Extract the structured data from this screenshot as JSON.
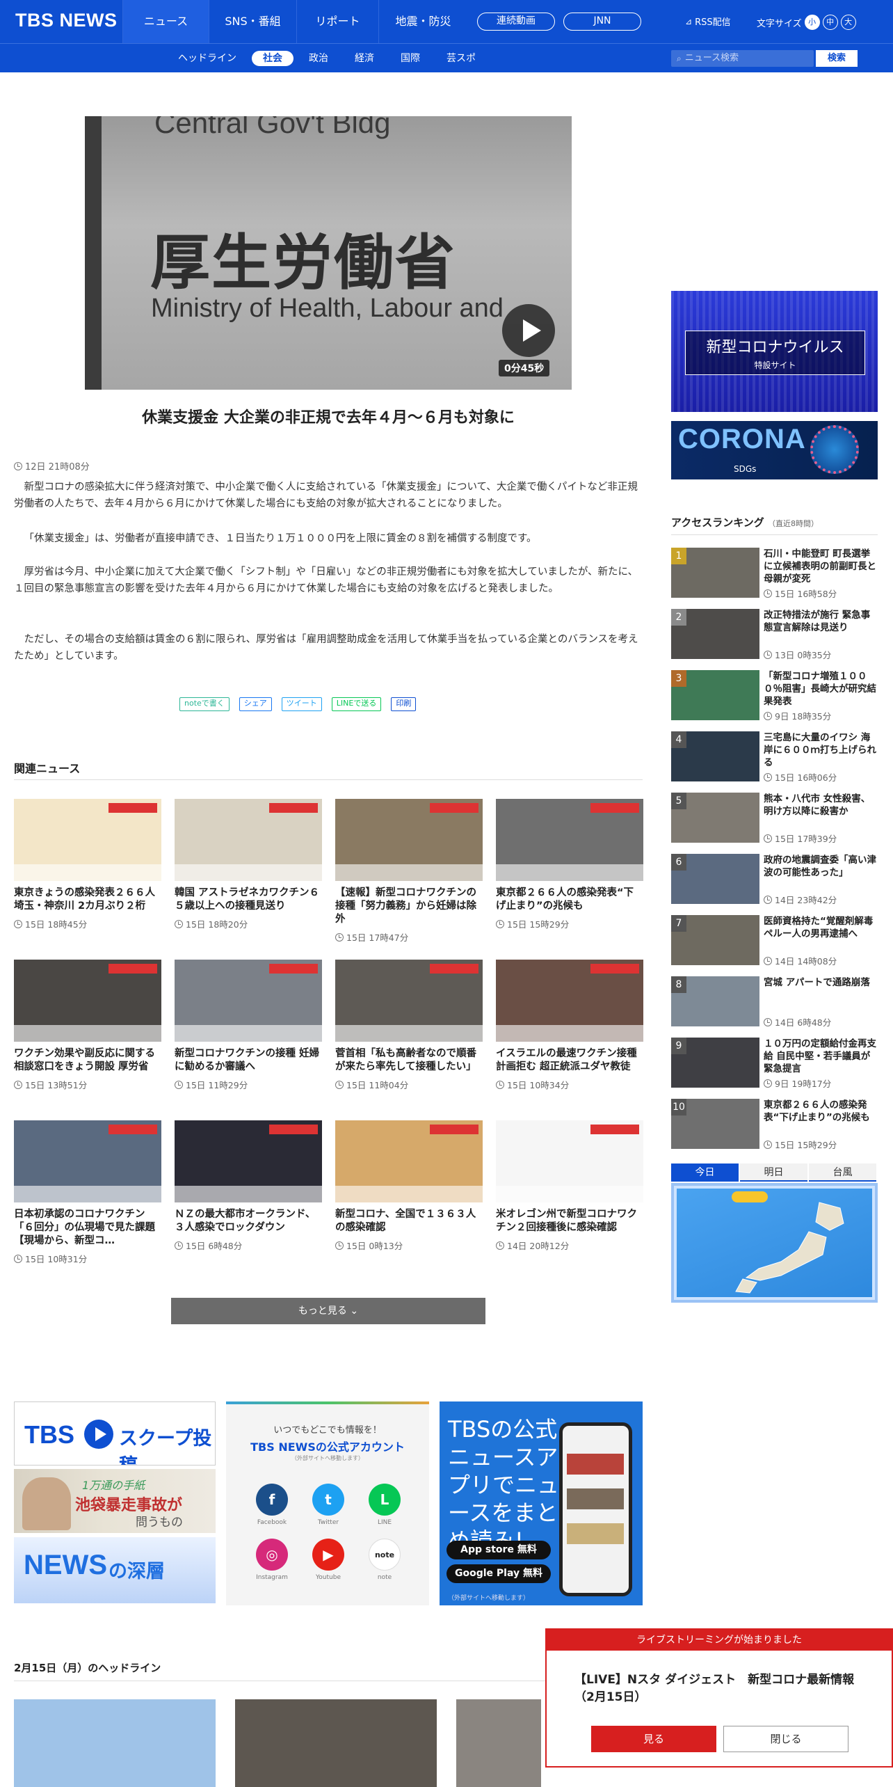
{
  "header": {
    "logo": "TBS NEWS",
    "nav": [
      {
        "label": "ニュース",
        "w": 124,
        "active": true
      },
      {
        "label": "SNS・番組",
        "w": 126
      },
      {
        "label": "リポート",
        "w": 118
      },
      {
        "label": "地震・防災",
        "w": 128
      }
    ],
    "pill_live": "連続動画",
    "pill_jnn": "JNN",
    "rss": "RSS配信",
    "font_size_label": "文字サイズ",
    "font_small": "小",
    "font_mid": "中",
    "font_large": "大"
  },
  "subnav": {
    "items": [
      "ヘッドライン",
      "社会",
      "政治",
      "経済",
      "国際",
      "芸スポ"
    ],
    "active_index": 1,
    "search_placeholder": "ニュース検索",
    "search_button": "検索"
  },
  "article": {
    "video_text_top": "Central Gov't Bldg",
    "video_text_big": "厚生労働省",
    "video_text_en": "Ministry of Health, Labour and",
    "duration": "0分45秒",
    "title": "休業支援金 大企業の非正規で去年４月～６月も対象に",
    "date": "12日 21時08分",
    "paragraphs": [
      "新型コロナの感染拡大に伴う経済対策で、中小企業で働く人に支給されている「休業支援金」について、大企業で働くパイトなど非正規労働者の人たちで、去年４月から６月にかけて休業した場合にも支給の対象が拡大されることになりました。",
      "「休業支援金」は、労働者が直接申請でき、１日当たり１万１０００円を上限に賃金の８割を補償する制度です。",
      "厚労省は今月、中小企業に加えて大企業で働く「シフト制」や「日雇い」などの非正規労働者にも対象を拡大していましたが、新たに、１回目の緊急事態宣言の影響を受けた去年４月から６月にかけて休業した場合にも支給の対象を広げると発表しました。",
      "ただし、その場合の支給額は賃金の６割に限られ、厚労省は「雇用調整助成金を活用して休業手当を払っている企業とのバランスを考えたため」としています。"
    ],
    "share": [
      {
        "label": "noteで書く",
        "color": "#2cb696"
      },
      {
        "label": "シェア",
        "color": "#1877f2"
      },
      {
        "label": "ツイート",
        "color": "#1da1f2"
      },
      {
        "label": "LINEで送る",
        "color": "#06c755"
      },
      {
        "label": "印刷",
        "color": "#0e4fd1"
      }
    ]
  },
  "related": {
    "title": "関連ニュース",
    "items": [
      {
        "title": "東京きょうの感染発表２６６人 埼玉・神奈川 2カ月ぶり２桁",
        "time": "15日 18時45分",
        "bg": "#f3e6c8"
      },
      {
        "title": "韓国 アストラゼネカワクチン６５歳以上への接種見送り",
        "time": "15日 18時20分",
        "bg": "#d9d2c2"
      },
      {
        "title": "【速報】新型コロナワクチンの接種「努力義務」から妊婦は除外",
        "time": "15日 17時47分",
        "bg": "#8a7a62"
      },
      {
        "title": "東京都２６６人の感染発表“下げ止まり”の兆候も",
        "time": "15日 15時29分",
        "bg": "#6f6f6f"
      },
      {
        "title": "ワクチン効果や副反応に関する相談窓口をきょう開設 厚労省",
        "time": "15日 13時51分",
        "bg": "#4a4744"
      },
      {
        "title": "新型コロナワクチンの接種 妊婦に勧めるか審議へ",
        "time": "15日 11時29分",
        "bg": "#7b8088"
      },
      {
        "title": "菅首相「私も高齢者なので順番が来たら率先して接種したい」",
        "time": "15日 11時04分",
        "bg": "#5e5a55"
      },
      {
        "title": "イスラエルの最速ワクチン接種計画拒む 超正統派ユダヤ教徒",
        "time": "15日 10時34分",
        "bg": "#6a4f45"
      },
      {
        "title": "日本初承認のコロナワクチン「６回分」の仏現場で見た課題【現場から、新型コ…",
        "time": "15日 10時31分",
        "bg": "#5a6a80"
      },
      {
        "title": "ＮＺの最大都市オークランド、３人感染でロックダウン",
        "time": "15日 6時48分",
        "bg": "#2a2a35"
      },
      {
        "title": "新型コロナ、全国で１３６３人の感染確認",
        "time": "15日 0時13分",
        "bg": "#d6a96a"
      },
      {
        "title": "米オレゴン州で新型コロナワクチン２回接種後に感染確認",
        "time": "14日 20時12分",
        "bg": "#f6f6f6"
      }
    ],
    "more": "もっと見る"
  },
  "banners": {
    "scoop_a": "TBS",
    "scoop_b": "スクープ投稿",
    "ike_a": "1万通の手紙",
    "ike_b": "池袋暴走事故が",
    "ike_c": "問うもの",
    "fuka_a": "NEWS",
    "fuka_b": "の深層",
    "sns_line1": "いつでもどこでも情報を！",
    "sns_line2": "TBS NEWSの公式アカウント",
    "sns_line3": "（外部サイトへ移動します）",
    "sns": [
      {
        "label": "Facebook",
        "glyph": "f",
        "color": "#1b4f8a"
      },
      {
        "label": "Twitter",
        "glyph": "t",
        "color": "#1da1f2"
      },
      {
        "label": "LINE",
        "glyph": "L",
        "color": "#06c755"
      },
      {
        "label": "Instagram",
        "glyph": "◎",
        "color": "#d6297a"
      },
      {
        "label": "Youtube",
        "glyph": "▶",
        "color": "#e62117"
      },
      {
        "label": "note",
        "glyph": "note",
        "color": "#ffffff"
      }
    ],
    "app_text": "TBSの公式ニュースアプリでニュースをまとめ読み!",
    "app_store": "App store 無料",
    "google_play": "Google Play 無料",
    "app_small": "（外部サイトへ移動します）"
  },
  "sidebar": {
    "banner1_title": "新型コロナウイルス",
    "banner1_sub": "特設サイト",
    "banner2_title": "CORONA",
    "banner2_sub": "SDGs",
    "ranking_title": "アクセスランキング",
    "ranking_note": "（直近8時間）",
    "ranking": [
      {
        "n": "1",
        "title": "石川・中能登町 町長選挙に立候補表明の前副町長と母親が変死",
        "time": "15日 16時58分",
        "color": "#c9a42a",
        "bg": "#6d6a62"
      },
      {
        "n": "2",
        "title": "改正特措法が施行 緊急事態宣言解除は見送り",
        "time": "13日 0時35分",
        "color": "#8a8a8a",
        "bg": "#4e4c4a"
      },
      {
        "n": "3",
        "title": "「新型コロナ増殖１０００％阻害」長崎大が研究結果発表",
        "time": "9日 18時35分",
        "color": "#b06a2a",
        "bg": "#3f7a56"
      },
      {
        "n": "4",
        "title": "三宅島に大量のイワシ 海岸に６００ｍ打ち上げられる",
        "time": "15日 16時06分",
        "color": "#555",
        "bg": "#2b3a4a"
      },
      {
        "n": "5",
        "title": "熊本・八代市 女性殺害、明け方以降に殺害か",
        "time": "15日 17時39分",
        "color": "#555",
        "bg": "#7f7a72"
      },
      {
        "n": "6",
        "title": "政府の地震調査委「高い津波の可能性あった」",
        "time": "14日 23時42分",
        "color": "#555",
        "bg": "#5b6a80"
      },
      {
        "n": "7",
        "title": "医師資格持た“覚醒剤解毒 ペルー人の男再逮捕へ",
        "time": "14日 14時08分",
        "color": "#555",
        "bg": "#6e6a60"
      },
      {
        "n": "8",
        "title": "宮城 アパートで通路崩落",
        "time": "14日 6時48分",
        "color": "#555",
        "bg": "#7e8a96"
      },
      {
        "n": "9",
        "title": "１０万円の定額給付金再支給 自民中堅・若手議員が緊急提言",
        "time": "9日 19時17分",
        "color": "#555",
        "bg": "#3f3f44"
      },
      {
        "n": "10",
        "title": "東京都２６６人の感染発表“下げ止まり”の兆候も",
        "time": "15日 15時29分",
        "color": "#555",
        "bg": "#6f6f6f"
      }
    ],
    "weather_tabs": [
      "今日",
      "明日",
      "台風"
    ],
    "weather_active": 0
  },
  "headline_section": {
    "title": "2月15日（月）のヘッドライン",
    "tiles": [
      "#9fc3e8",
      "#5d5750",
      "#8a8580"
    ]
  },
  "popup": {
    "header": "ライブストリーミングが始まりました",
    "body": "【LIVE】Nスタ ダイジェスト　新型コロナ最新情報（2月15日）",
    "view": "見る",
    "close": "閉じる"
  }
}
